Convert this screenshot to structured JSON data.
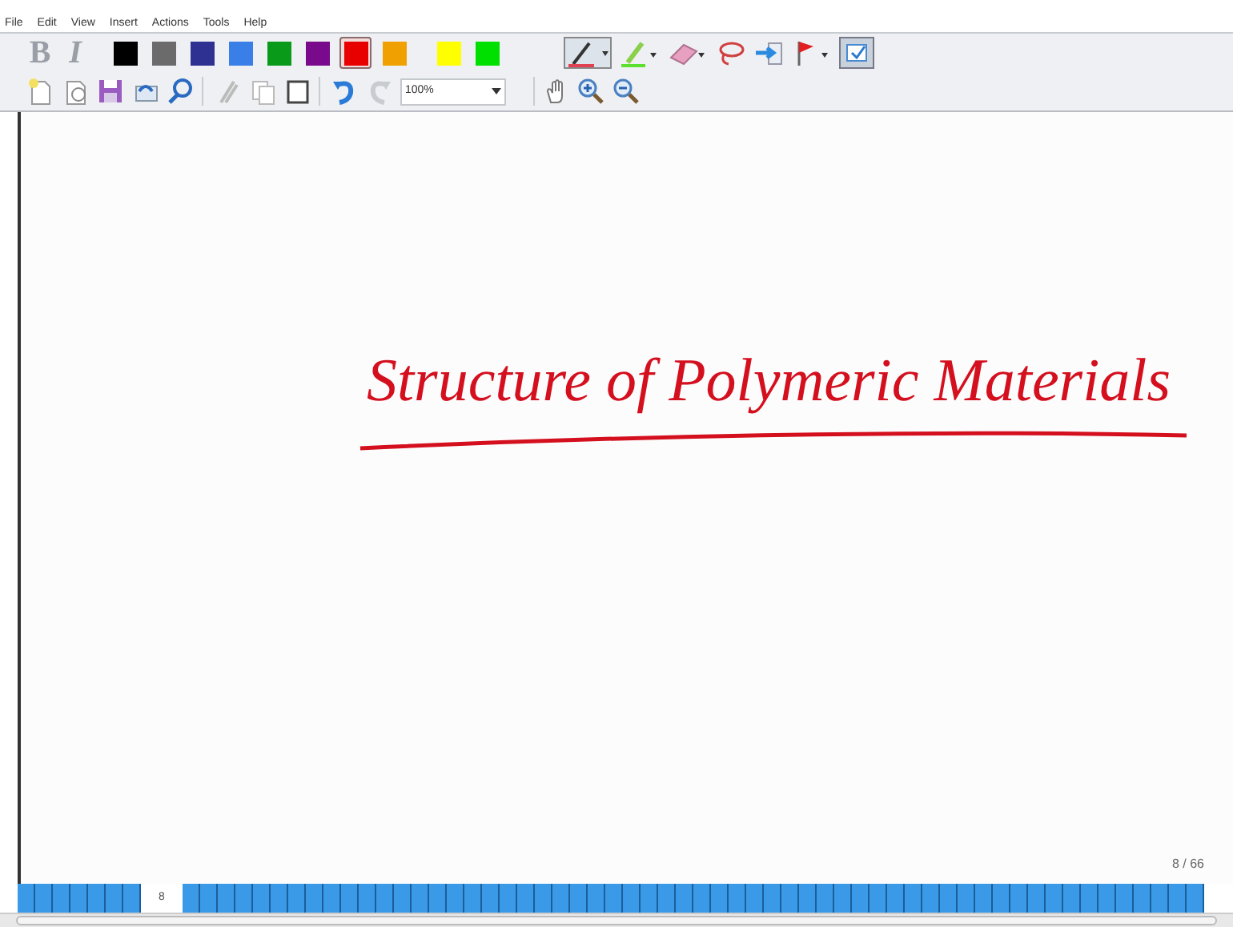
{
  "menu": [
    "File",
    "Edit",
    "View",
    "Insert",
    "Actions",
    "Tools",
    "Help"
  ],
  "format_buttons": [
    {
      "label": "B",
      "disabled": true
    },
    {
      "label": "I",
      "disabled": true
    }
  ],
  "pen_colors": [
    {
      "color": "#000000",
      "selected": false
    },
    {
      "color": "#6b6b6b",
      "selected": false
    },
    {
      "color": "#2e3192",
      "selected": false
    },
    {
      "color": "#3a7ee8",
      "selected": false
    },
    {
      "color": "#0a9a1a",
      "selected": false
    },
    {
      "color": "#7a0a8c",
      "selected": false
    },
    {
      "color": "#e80000",
      "selected": true
    },
    {
      "color": "#f0a000",
      "selected": false
    },
    {
      "color": "#ffff00",
      "selected": false
    },
    {
      "color": "#00e000",
      "selected": false
    }
  ],
  "zoom": {
    "value": "100%"
  },
  "note": {
    "title": "Structure of Polymeric Materials",
    "color": "#d4101e"
  },
  "page_indicator": "8 / 66",
  "page_tabs": [
    {
      "selected": false
    },
    {
      "selected": false
    },
    {
      "selected": false
    },
    {
      "selected": false
    },
    {
      "selected": false
    },
    {
      "selected": false
    },
    {
      "selected": false
    },
    {
      "selected": true,
      "label": "8"
    },
    {
      "selected": false
    },
    {
      "selected": false
    },
    {
      "selected": false
    },
    {
      "selected": false
    },
    {
      "selected": false
    },
    {
      "selected": false
    },
    {
      "selected": false
    },
    {
      "selected": false
    },
    {
      "selected": false
    },
    {
      "selected": false
    },
    {
      "selected": false
    },
    {
      "selected": false
    },
    {
      "selected": false
    },
    {
      "selected": false
    },
    {
      "selected": false
    },
    {
      "selected": false
    },
    {
      "selected": false
    },
    {
      "selected": false
    },
    {
      "selected": false
    },
    {
      "selected": false
    },
    {
      "selected": false
    },
    {
      "selected": false
    },
    {
      "selected": false
    },
    {
      "selected": false
    },
    {
      "selected": false
    },
    {
      "selected": false
    },
    {
      "selected": false
    },
    {
      "selected": false
    },
    {
      "selected": false
    },
    {
      "selected": false
    },
    {
      "selected": false
    },
    {
      "selected": false
    },
    {
      "selected": false
    },
    {
      "selected": false
    },
    {
      "selected": false
    },
    {
      "selected": false
    },
    {
      "selected": false
    },
    {
      "selected": false
    },
    {
      "selected": false
    },
    {
      "selected": false
    },
    {
      "selected": false
    },
    {
      "selected": false
    },
    {
      "selected": false
    },
    {
      "selected": false
    },
    {
      "selected": false
    },
    {
      "selected": false
    },
    {
      "selected": false
    },
    {
      "selected": false
    },
    {
      "selected": false
    },
    {
      "selected": false
    },
    {
      "selected": false
    },
    {
      "selected": false
    },
    {
      "selected": false
    },
    {
      "selected": false
    },
    {
      "selected": false
    },
    {
      "selected": false
    },
    {
      "selected": false
    },
    {
      "selected": false
    }
  ]
}
